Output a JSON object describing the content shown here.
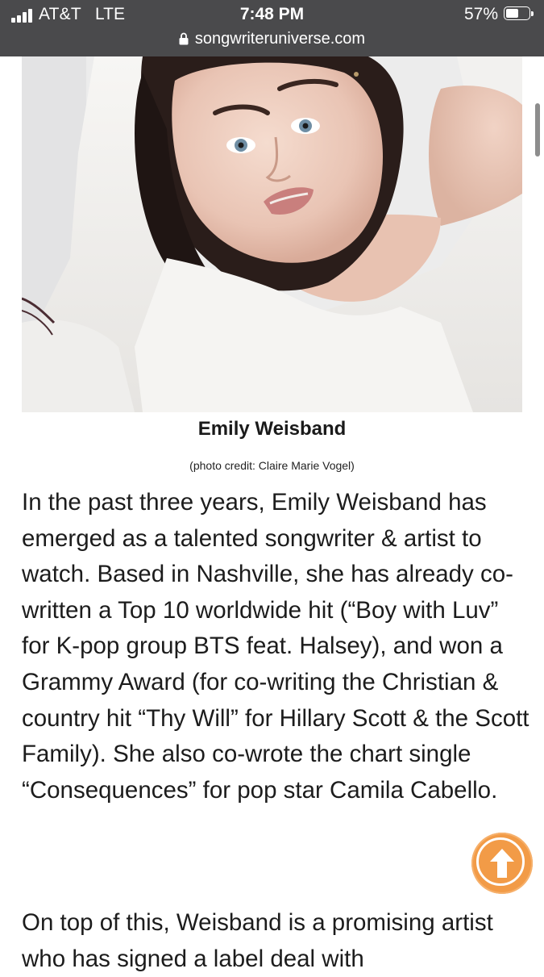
{
  "status_bar": {
    "carrier": "AT&T",
    "network": "LTE",
    "time": "7:48 PM",
    "battery_percent": "57%",
    "battery_level": 0.57,
    "url": "songwriteruniverse.com"
  },
  "article": {
    "photo_alt": "Emily Weisband",
    "caption_name": "Emily Weisband",
    "caption_credit": "(photo credit: Claire Marie Vogel)",
    "paragraph_1": "In the past three years, Emily Weisband has emerged as a talented songwriter & artist to watch. Based in Nashville, she has already co-written a Top 10 worldwide hit (“Boy with Luv” for K-pop group BTS feat. Halsey), and won a Grammy Award (for co-writing the Christian & country hit “Thy Will” for Hillary Scott & the Scott Family). She also co-wrote the chart single “Consequences” for pop star Camila Cabello.",
    "paragraph_2": "On top of this, Weisband is a promising artist who has signed a label deal with"
  },
  "colors": {
    "status_bar_bg": "#4a4a4c",
    "scroll_button": "#f29b47"
  },
  "icons": {
    "lock": "lock-icon",
    "scroll_top": "arrow-up-icon"
  }
}
